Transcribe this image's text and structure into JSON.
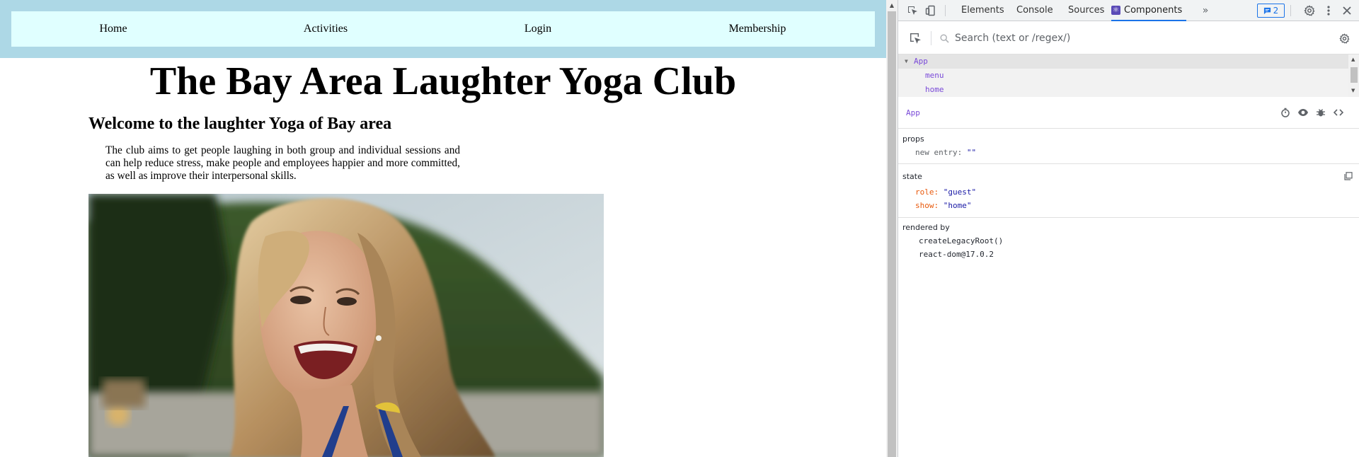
{
  "nav": {
    "items": [
      {
        "label": "Home"
      },
      {
        "label": "Activities"
      },
      {
        "label": "Login"
      },
      {
        "label": "Membership"
      }
    ]
  },
  "page": {
    "title": "The Bay Area Laughter Yoga Club",
    "welcome": "Welcome to the laughter Yoga of Bay area",
    "intro": "The club aims to get people laughing in both group and individual sessions and can help reduce stress, make people and employees happier and more committed, as well as improve their interpersonal skills."
  },
  "devtools": {
    "tabs": [
      {
        "label": "Elements"
      },
      {
        "label": "Console"
      },
      {
        "label": "Sources"
      },
      {
        "label": "Components",
        "active": true
      }
    ],
    "issues_count": "2",
    "search": {
      "placeholder": "Search (text or /regex/)"
    },
    "tree": {
      "root": "App",
      "children": [
        {
          "label": "menu"
        },
        {
          "label": "home"
        }
      ]
    },
    "inspector": {
      "component": "App",
      "props": {
        "title": "props",
        "items": [
          {
            "key": "new entry:",
            "value": "\"\""
          }
        ]
      },
      "state": {
        "title": "state",
        "items": [
          {
            "key": "role:",
            "value": "\"guest\""
          },
          {
            "key": "show:",
            "value": "\"home\""
          }
        ]
      },
      "rendered_by": {
        "title": "rendered by",
        "items": [
          "createLegacyRoot()",
          "react-dom@17.0.2"
        ]
      }
    }
  },
  "colors": {
    "nav_outer": "#add8e6",
    "nav_inner": "#e0ffff",
    "devtools_accent": "#1a73e8",
    "component_name": "#7a4ad8",
    "state_key": "#e8590c",
    "string_value": "#1a1aa6"
  },
  "icons": [
    "inspect-element-icon",
    "device-toolbar-icon",
    "react-components-icon",
    "more-tabs-icon",
    "issues-icon",
    "settings-gear-icon",
    "kebab-menu-icon",
    "close-icon",
    "component-picker-icon",
    "search-icon",
    "tree-settings-icon",
    "stopwatch-icon",
    "eye-icon",
    "bug-icon",
    "view-source-icon",
    "copy-icon"
  ]
}
